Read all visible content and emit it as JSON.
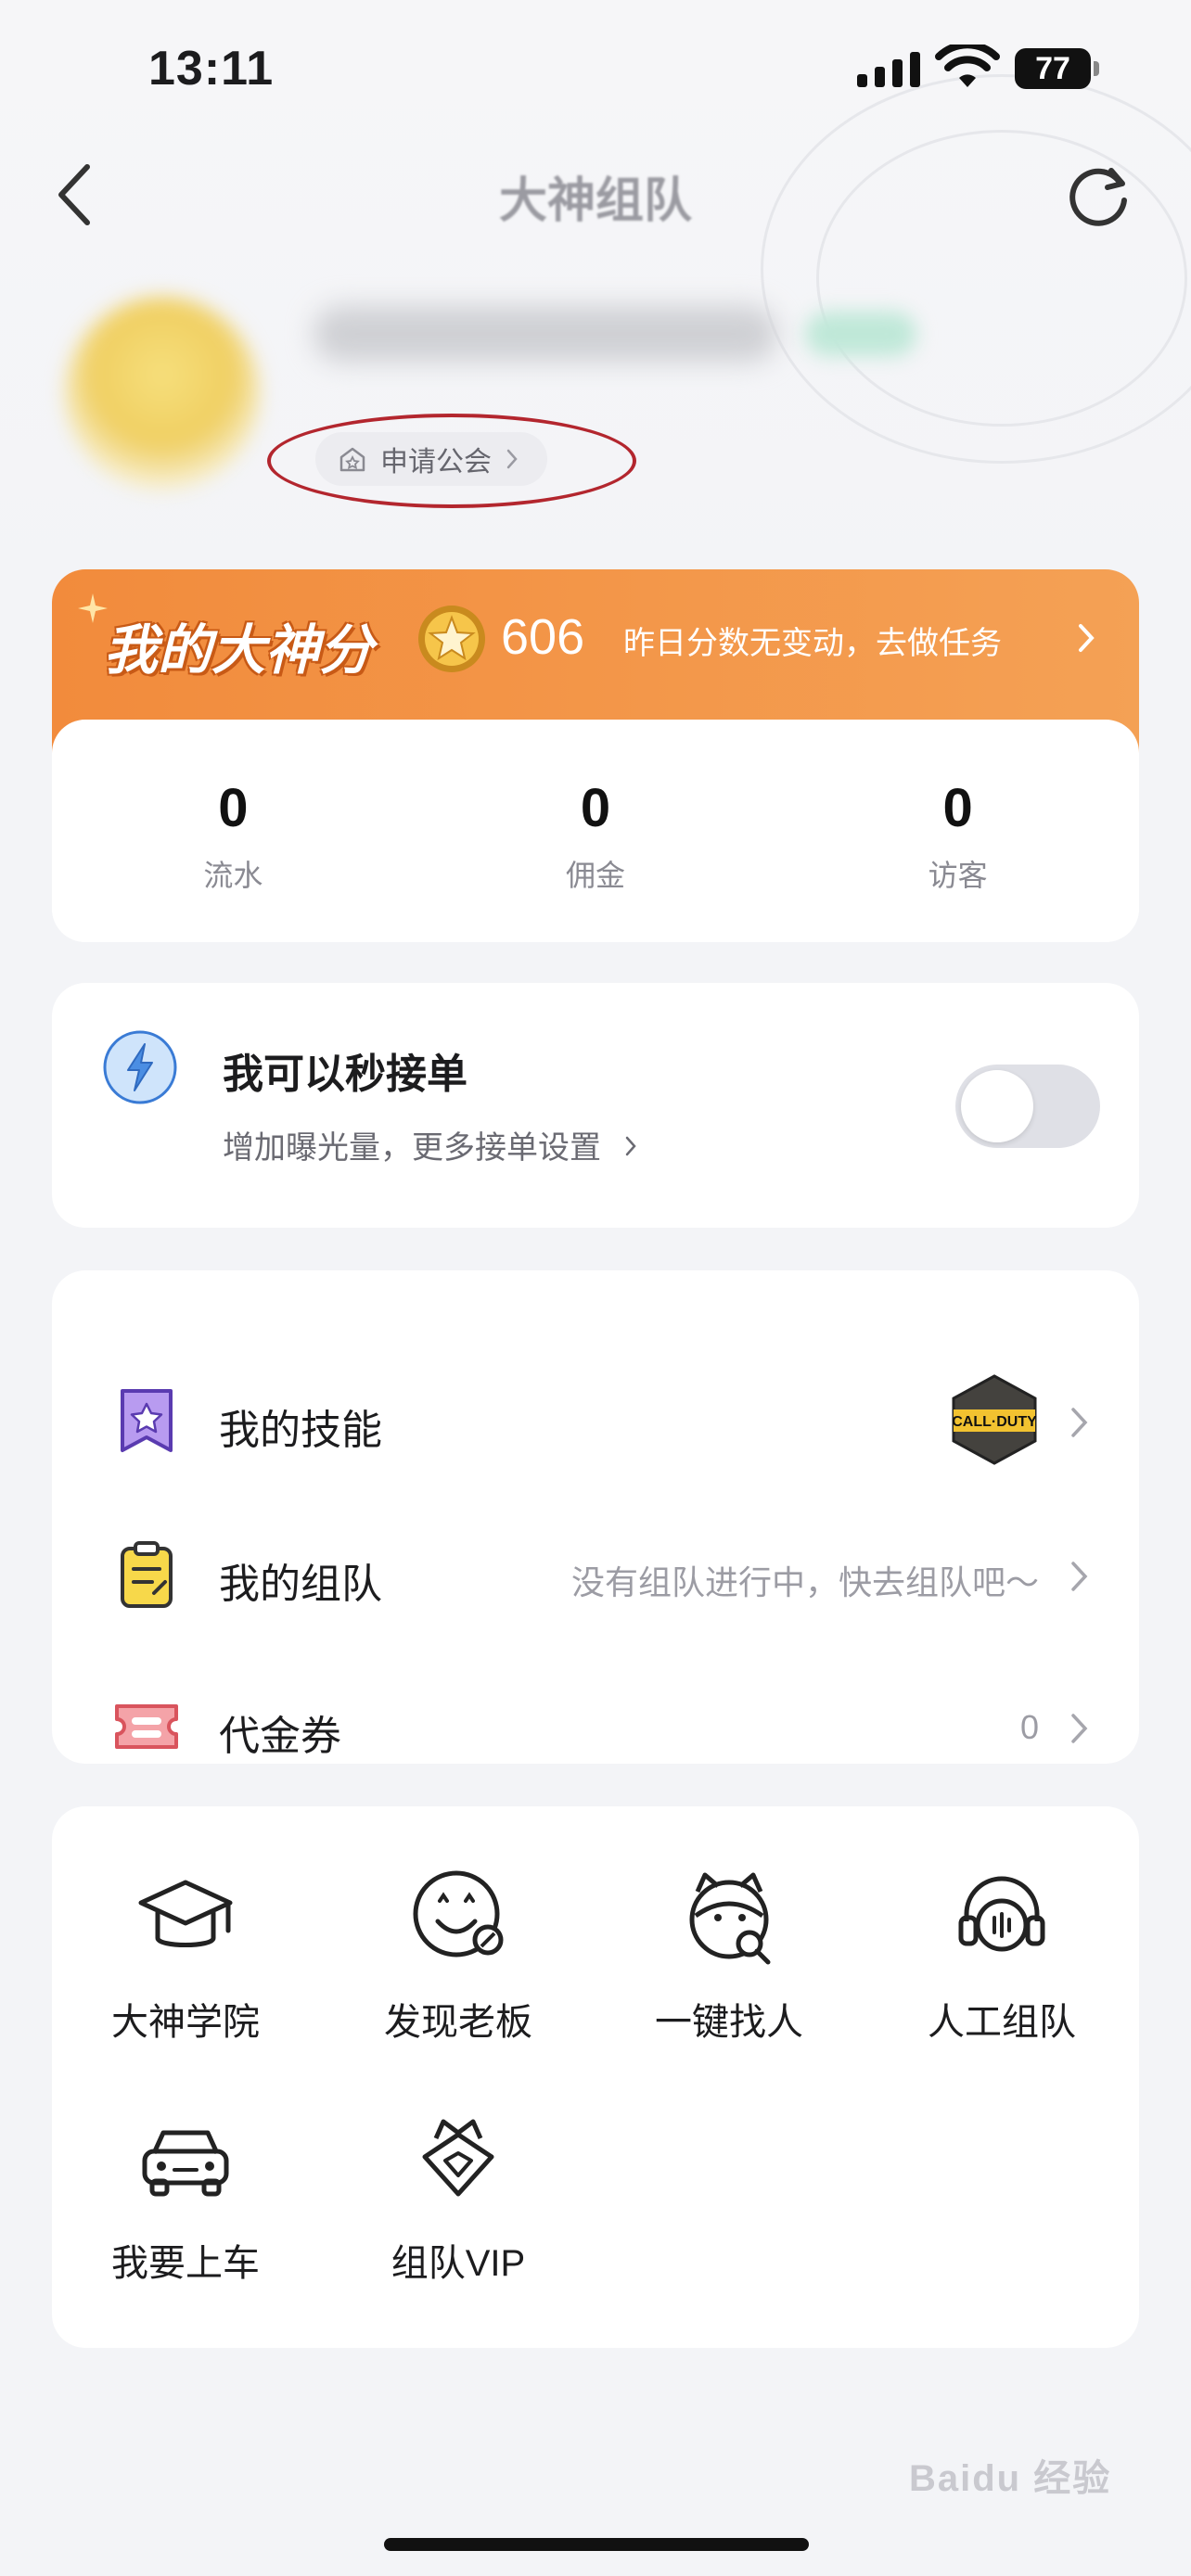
{
  "status_bar": {
    "time": "13:11",
    "battery": "77"
  },
  "header": {
    "title": "大神组队"
  },
  "profile": {
    "apply_guild_label": "申请公会"
  },
  "score": {
    "title": "我的大神分",
    "value": "606",
    "tip": "昨日分数无变动，去做任务",
    "stats": [
      {
        "value": "0",
        "label": "流水"
      },
      {
        "value": "0",
        "label": "佣金"
      },
      {
        "value": "0",
        "label": "访客"
      }
    ]
  },
  "quick_order": {
    "title": "我可以秒接单",
    "subtitle": "增加曝光量，更多接单设置",
    "enabled": false
  },
  "menu": {
    "skills": {
      "label": "我的技能",
      "badge": "CALL·DUTY"
    },
    "team": {
      "label": "我的组队",
      "value": "没有组队进行中，快去组队吧～"
    },
    "voucher": {
      "label": "代金券",
      "value": "0"
    }
  },
  "tools": [
    {
      "label": "大神学院",
      "icon": "graduation-cap-icon"
    },
    {
      "label": "发现老板",
      "icon": "smiley-face-icon"
    },
    {
      "label": "一键找人",
      "icon": "mascot-search-icon"
    },
    {
      "label": "人工组队",
      "icon": "headset-icon"
    },
    {
      "label": "我要上车",
      "icon": "car-icon"
    },
    {
      "label": "组队VIP",
      "icon": "vip-crown-icon"
    }
  ],
  "watermark": "Baidu 经验",
  "colors": {
    "accent_orange": "#f28b3c",
    "highlight_red": "#b3262e",
    "toggle_off": "#dfe0e6"
  }
}
